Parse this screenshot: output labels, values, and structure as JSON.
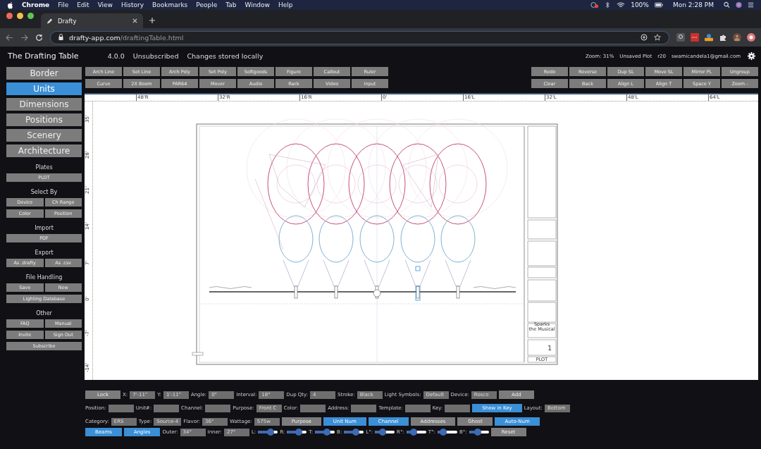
{
  "menubar": {
    "app": "Chrome",
    "menus": [
      "File",
      "Edit",
      "View",
      "History",
      "Bookmarks",
      "People",
      "Tab",
      "Window",
      "Help"
    ],
    "battery": "100%",
    "clock": "Mon 2:28 PM"
  },
  "browser": {
    "tab": {
      "title": "Drafty"
    },
    "url": {
      "host": "drafty-app.com",
      "path": "/draftingTable.html"
    }
  },
  "header": {
    "title": "The Drafting Table",
    "version": "4.0.0",
    "subscription": "Unsubscribed",
    "storage": "Changes stored locally",
    "zoom": "Zoom: 31%",
    "plot_status": "Unsaved Plot",
    "revision": "r20",
    "email": "swamicandela1@gmail.com"
  },
  "sidebar": {
    "modes": [
      {
        "label": "Border",
        "selected": false
      },
      {
        "label": "Units",
        "selected": true
      },
      {
        "label": "Dimensions",
        "selected": false
      },
      {
        "label": "Positions",
        "selected": false
      },
      {
        "label": "Scenery",
        "selected": false
      },
      {
        "label": "Architecture",
        "selected": false
      }
    ],
    "sections": [
      {
        "title": "Plates",
        "rows": [
          [
            "PLOT"
          ]
        ]
      },
      {
        "title": "Select By",
        "rows": [
          [
            "Device",
            "Ch Range"
          ],
          [
            "Color",
            "Position"
          ]
        ]
      },
      {
        "title": "Import",
        "rows": [
          [
            "PDF"
          ]
        ]
      },
      {
        "title": "Export",
        "rows": [
          [
            "As .drafty",
            "As .csv"
          ]
        ]
      },
      {
        "title": "File Handling",
        "rows": [
          [
            "Save",
            "New"
          ],
          [
            "Lighting Database"
          ]
        ]
      },
      {
        "title": "Other",
        "rows": [
          [
            "FAQ",
            "Manual"
          ],
          [
            "Invite",
            "Sign Out"
          ],
          [
            "Subscribe"
          ]
        ]
      }
    ]
  },
  "toolbar": {
    "left": [
      [
        "Arch Line",
        "Set Line",
        "Arch Poly",
        "Set Poly",
        "Softgoods",
        "Figure",
        "Callout",
        "Ruler"
      ],
      [
        "Curve",
        "2X Boom",
        "PAR64",
        "Mover",
        "Audio",
        "Rack",
        "Video",
        "Input"
      ]
    ],
    "right": [
      [
        "Redo",
        "Reverse",
        "Dup SL",
        "Move SL",
        "Mirror PL",
        "Ungroup"
      ],
      [
        "Clear",
        "Back",
        "Align L",
        "Align T",
        "Space Y",
        "Zoom -"
      ]
    ]
  },
  "canvas": {
    "x_ruler": [
      "48'R",
      "32'R",
      "16'R",
      "0'",
      "16'L",
      "32'L",
      "48'L",
      "64'L"
    ],
    "y_ruler": [
      "35'",
      "28'",
      "21'",
      "14'",
      "7'",
      "0'",
      "-7'",
      "-14'"
    ],
    "title_block": {
      "show_lines": [
        "Sparks",
        "the Musical"
      ],
      "plate_number": "1",
      "plate_name": "PLOT"
    }
  },
  "properties": {
    "lines": [
      [
        {
          "kind": "button",
          "label": "Lock",
          "on": false
        },
        {
          "kind": "field",
          "label": "X:",
          "value": "7'-11\""
        },
        {
          "kind": "field",
          "label": "Y:",
          "value": "1'-11\""
        },
        {
          "kind": "field",
          "label": "Angle:",
          "value": "0°"
        },
        {
          "kind": "field",
          "label": "Interval:",
          "value": "18°"
        },
        {
          "kind": "field",
          "label": "Dup Qty:",
          "value": "4"
        },
        {
          "kind": "field",
          "label": "Stroke:",
          "value": "Black"
        },
        {
          "kind": "field",
          "label": "Light Symbols:",
          "value": "Default"
        },
        {
          "kind": "field",
          "label": "Device:",
          "value": "Rosco"
        },
        {
          "kind": "button",
          "label": "Add",
          "on": false
        }
      ],
      [
        {
          "kind": "field",
          "label": "Position:"
        },
        {
          "kind": "field",
          "label": "Unit#:"
        },
        {
          "kind": "field",
          "label": "Channel:"
        },
        {
          "kind": "field",
          "label": "Purpose:",
          "value": "Front C"
        },
        {
          "kind": "field",
          "label": "Color:"
        },
        {
          "kind": "field",
          "label": "Address:"
        },
        {
          "kind": "field",
          "label": "Template:"
        },
        {
          "kind": "field",
          "label": "Key:"
        },
        {
          "kind": "button",
          "label": "Show in Key",
          "on": true
        },
        {
          "kind": "field",
          "label": "Layout:",
          "value": "Bottom"
        }
      ],
      [
        {
          "kind": "field",
          "label": "Category:",
          "value": "ERS"
        },
        {
          "kind": "field",
          "label": "Type:",
          "value": "Source-4"
        },
        {
          "kind": "field",
          "label": "Flavor:",
          "value": "36°"
        },
        {
          "kind": "field",
          "label": "Wattage:",
          "value": "575w"
        },
        {
          "kind": "button",
          "label": "Purpose",
          "on": false
        },
        {
          "kind": "button",
          "label": "Unit Num",
          "on": true
        },
        {
          "kind": "button",
          "label": "Channel",
          "on": true
        },
        {
          "kind": "button",
          "label": "Addresses",
          "on": false
        },
        {
          "kind": "button",
          "label": "Ghost",
          "on": false
        },
        {
          "kind": "button",
          "label": "Auto-Num",
          "on": true
        }
      ],
      [
        {
          "kind": "button",
          "label": "Beams",
          "on": true
        },
        {
          "kind": "button",
          "label": "Angles",
          "on": true
        },
        {
          "kind": "field",
          "label": "Outer:",
          "value": "34°"
        },
        {
          "kind": "field",
          "label": "Inner:",
          "value": "27°"
        },
        {
          "kind": "slider",
          "label": "L:",
          "level": 0.65
        },
        {
          "kind": "slider",
          "label": "R:",
          "level": 0.6
        },
        {
          "kind": "slider",
          "label": "T:",
          "level": 0.6
        },
        {
          "kind": "slider",
          "label": "B:",
          "level": 0.6
        },
        {
          "kind": "slider",
          "label": "L°:",
          "level": 0.4
        },
        {
          "kind": "slider",
          "label": "R°:",
          "level": 0.35
        },
        {
          "kind": "slider",
          "label": "T°:",
          "level": 0.3
        },
        {
          "kind": "slider",
          "label": "B°:",
          "level": 0.45
        },
        {
          "kind": "button",
          "label": "Reset",
          "on": false
        }
      ]
    ]
  }
}
